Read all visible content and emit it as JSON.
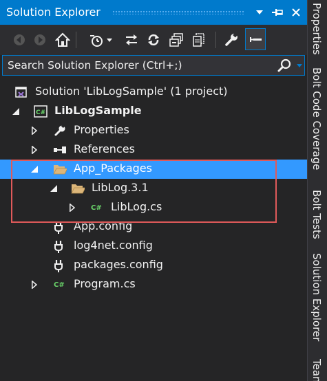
{
  "window": {
    "title": "Solution Explorer",
    "accent": "#007acc",
    "controls": {
      "dropdown_icon": "dropdown-arrow-icon",
      "pin_icon": "pin-icon",
      "close_icon": "close-icon"
    }
  },
  "toolbar": {
    "buttons": [
      "back-icon",
      "forward-icon",
      "home-icon",
      "pending-changes-filter-icon",
      "sync-icon",
      "refresh-icon",
      "collapse-all-icon",
      "show-all-files-icon",
      "properties-icon",
      "preview-selected-icon"
    ]
  },
  "search": {
    "placeholder": "Search Solution Explorer (Ctrl+;)"
  },
  "tree": {
    "solution": "Solution 'LibLogSample' (1 project)",
    "project": "LibLogSample",
    "properties": "Properties",
    "references": "References",
    "app_packages": "App_Packages",
    "liblog_folder": "LibLog.3.1",
    "liblog_cs": "LibLog.cs",
    "app_config": "App.config",
    "log4net_config": "log4net.config",
    "packages_config": "packages.config",
    "program_cs": "Program.cs",
    "selected_color": "#3399ff",
    "highlight_color": "#e05a5a"
  },
  "side_tabs": {
    "properties": "Properties",
    "bolt_coverage": "Bolt Code Coverage",
    "bolt_tests": "Bolt Tests",
    "solution_explorer": "Solution Explorer",
    "team": "Tean"
  }
}
